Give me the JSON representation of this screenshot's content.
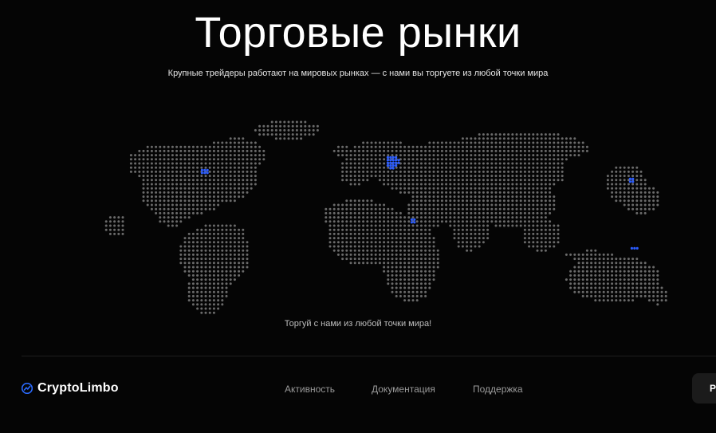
{
  "hero": {
    "title": "Торговые рынки",
    "subtitle": "Крупные трейдеры работают на мировых рынках — с нами вы торгуете из любой точки мира"
  },
  "map": {
    "caption": "Торгуй с нами из любой точки мира!",
    "dot_color": "#6b6b6b",
    "highlight_color": "#2b5cff"
  },
  "footer": {
    "brand": "CryptoLimbo",
    "brand_color": "#2b6bff",
    "nav": [
      "Активность",
      "Документация",
      "Поддержка"
    ],
    "cta_label": "Р"
  }
}
